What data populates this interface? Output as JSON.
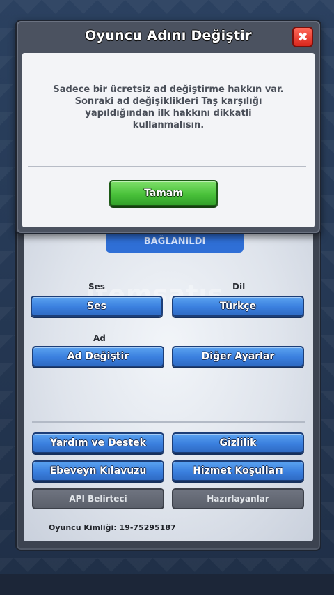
{
  "modal": {
    "title": "Oyuncu Adını Değiştir",
    "close_label": "✖",
    "message": "Sadece bir ücretsiz ad değiştirme hakkın var. Sonraki ad değişiklikleri Taş karşılığı yapıldığından ilk hakkını dikkatli kullanmalısın.",
    "ok_label": "Tamam"
  },
  "settings": {
    "linked_label": "BAĞLANILDI",
    "watermark": "itemsatış",
    "sound_label": "Ses",
    "sound_button": "Ses",
    "language_label": "Dil",
    "language_button": "Türkçe",
    "name_label": "Ad",
    "change_name_button": "Ad Değiştir",
    "other_settings_button": "Diğer Ayarlar",
    "help_button": "Yardım ve Destek",
    "privacy_button": "Gizlilik",
    "parent_guide_button": "Ebeveyn Kılavuzu",
    "terms_button": "Hizmet Koşulları",
    "api_button": "API Belirteci",
    "credits_button": "Hazırlayanlar",
    "player_id": "Oyuncu Kimliği: 19-75295187"
  },
  "colors": {
    "primary_button": "#3a7fde",
    "confirm_button": "#49c13a",
    "close_button": "#d9261c",
    "disabled_button": "#5b606b"
  },
  "icons": {
    "close": "close-icon"
  }
}
